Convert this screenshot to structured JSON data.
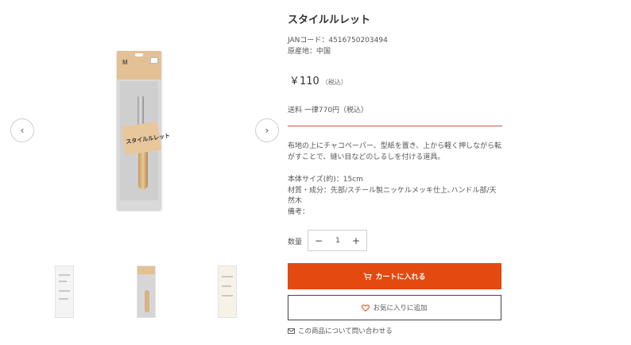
{
  "product": {
    "title": "スタイルルレット",
    "jan": "JANコード：4516750203494",
    "origin": "原産地：中国",
    "price": "￥110",
    "price_tax": "（税込）",
    "shipping": "送料 一律770円（税込）",
    "description": "布地の上にチャコペーパー、型紙を置き、上から軽く押しながら転がすことで、縫い目などのしるしを付ける道具。",
    "size": "本体サイズ(約)：15cm",
    "material": "材質・成分：先部/スチール製ニッケルメッキ仕上､ハンドル部/天然木",
    "notes": "備考："
  },
  "package": {
    "logo": "M",
    "label": "スタイルルレット"
  },
  "gallery": {
    "prev_icon": "chevron-left-icon",
    "next_icon": "chevron-right-icon",
    "prev_glyph": "‹",
    "next_glyph": "›"
  },
  "purchase": {
    "qty_label": "数量",
    "qty_value": "1",
    "minus": "−",
    "plus": "+",
    "cart_label": "カートに入れる",
    "favorite_label": "お気に入りに追加",
    "contact_label": "この商品について問い合わせる"
  },
  "colors": {
    "accent": "#e4490f",
    "divider": "#c65b3a"
  }
}
